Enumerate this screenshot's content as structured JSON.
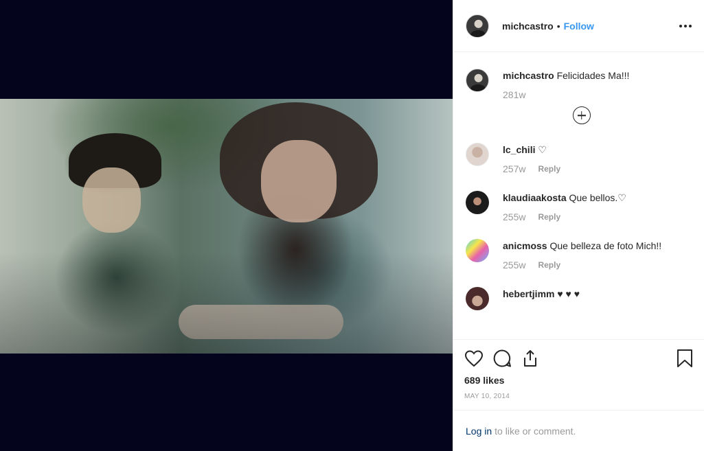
{
  "post": {
    "author": "michcastro",
    "separator": "•",
    "follow_label": "Follow",
    "caption": {
      "username": "michcastro",
      "text": "Felicidades Ma!!!",
      "age": "281w"
    },
    "comments": [
      {
        "username": "lc_chili",
        "text": "♡",
        "age": "257w",
        "reply_label": "Reply"
      },
      {
        "username": "klaudiaakosta",
        "text": "Que bellos.♡",
        "age": "255w",
        "reply_label": "Reply"
      },
      {
        "username": "anicmoss",
        "text": "Que belleza de foto Mich!!",
        "age": "255w",
        "reply_label": "Reply"
      },
      {
        "username": "hebertjimm",
        "text": "♥ ♥ ♥"
      }
    ],
    "likes": "689 likes",
    "date": "MAY 10, 2014",
    "login_link": "Log in",
    "login_text": "to like or comment."
  },
  "icons": [
    "heart-icon",
    "comment-icon",
    "share-icon",
    "bookmark-icon",
    "more-options-icon",
    "load-more-icon"
  ],
  "colors": {
    "link_blue": "#3897f0",
    "muted": "#999999",
    "media_bg": "#04051c"
  }
}
